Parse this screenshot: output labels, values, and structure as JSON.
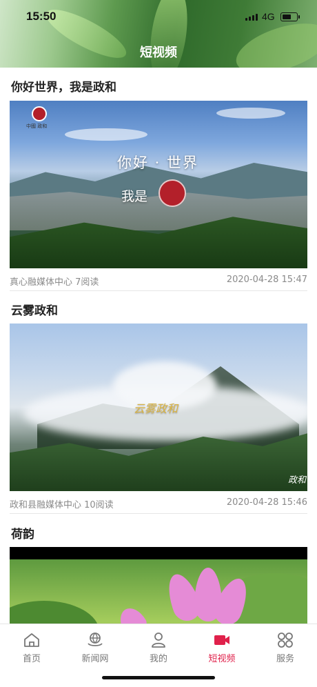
{
  "status_bar": {
    "time": "15:50",
    "network": "4G"
  },
  "header": {
    "title": "短视频"
  },
  "feed": [
    {
      "title": "你好世界，我是政和",
      "source": "真心融媒体中心 7阅读",
      "date": "2020-04-28 15:47",
      "overlay": {
        "line1": "你好 · 世界",
        "line2": "我是",
        "logo_caption": "中國 政和"
      }
    },
    {
      "title": "云雾政和",
      "source": "政和县融媒体中心 10阅读",
      "date": "2020-04-28 15:46",
      "overlay": {
        "caption": "云雾政和",
        "corner": "政和"
      }
    },
    {
      "title": "荷韵"
    }
  ],
  "tabbar": {
    "items": [
      {
        "label": "首页",
        "icon": "home-icon"
      },
      {
        "label": "新闻网",
        "icon": "globe-hand-icon"
      },
      {
        "label": "我的",
        "icon": "user-icon"
      },
      {
        "label": "短视频",
        "icon": "video-camera-icon",
        "active": true
      },
      {
        "label": "服务",
        "icon": "grid-circles-icon"
      }
    ]
  },
  "colors": {
    "accent": "#e0214b",
    "inactive": "#777777"
  }
}
